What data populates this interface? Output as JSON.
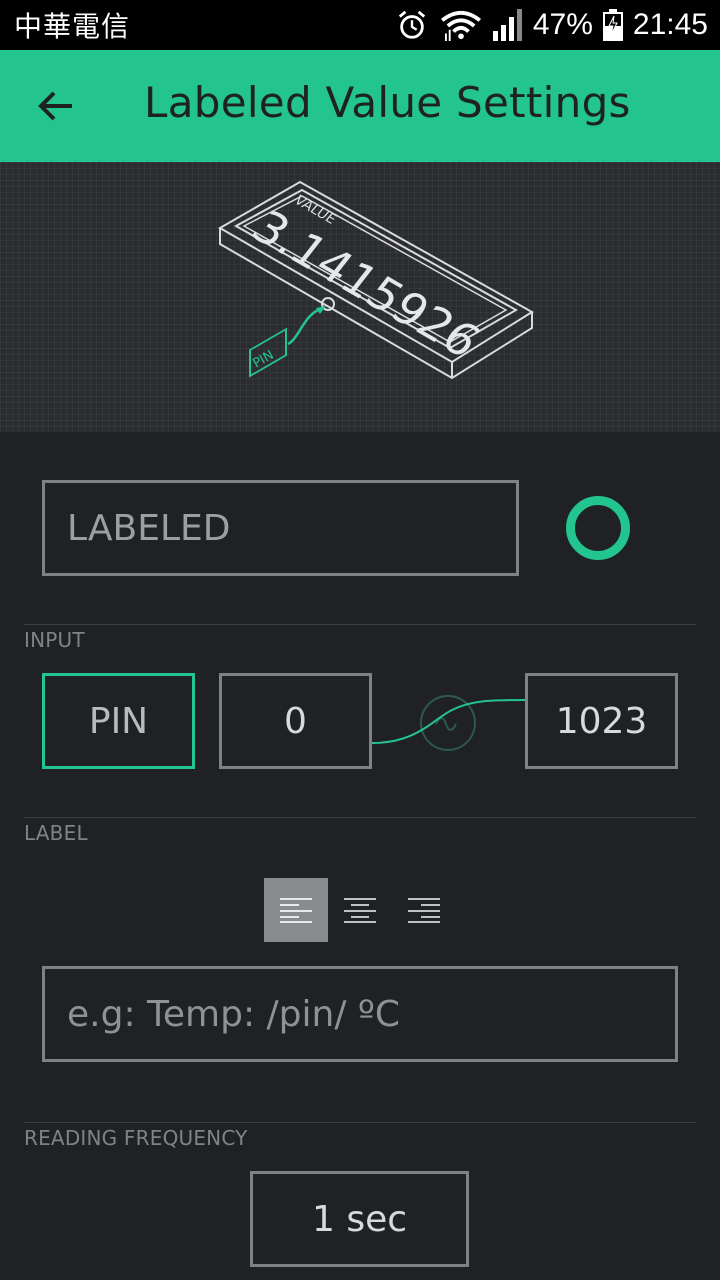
{
  "status_bar": {
    "carrier": "中華電信",
    "battery": "47%",
    "time": "21:45",
    "icons": [
      "alarm-icon",
      "wifi-icon",
      "signal-icon",
      "battery-charging-icon"
    ]
  },
  "app_bar": {
    "title": "Labeled Value Settings",
    "back_icon": "arrow-left-icon"
  },
  "hero": {
    "device_label": "VALUE",
    "device_value": "3.1415926",
    "pin_tag": "PIN"
  },
  "widget": {
    "name_value": "LABELED",
    "color": "#23c48e"
  },
  "input": {
    "section_label": "INPUT",
    "pin_label": "PIN",
    "min_value": "0",
    "max_value": "1023"
  },
  "label_section": {
    "section_label": "LABEL",
    "alignment_selected": "left",
    "placeholder": "e.g: Temp: /pin/ ºC"
  },
  "frequency": {
    "section_label": "READING FREQUENCY",
    "value": "1 sec"
  },
  "colors": {
    "accent": "#23c48e",
    "background": "#202125",
    "border": "#808185"
  }
}
